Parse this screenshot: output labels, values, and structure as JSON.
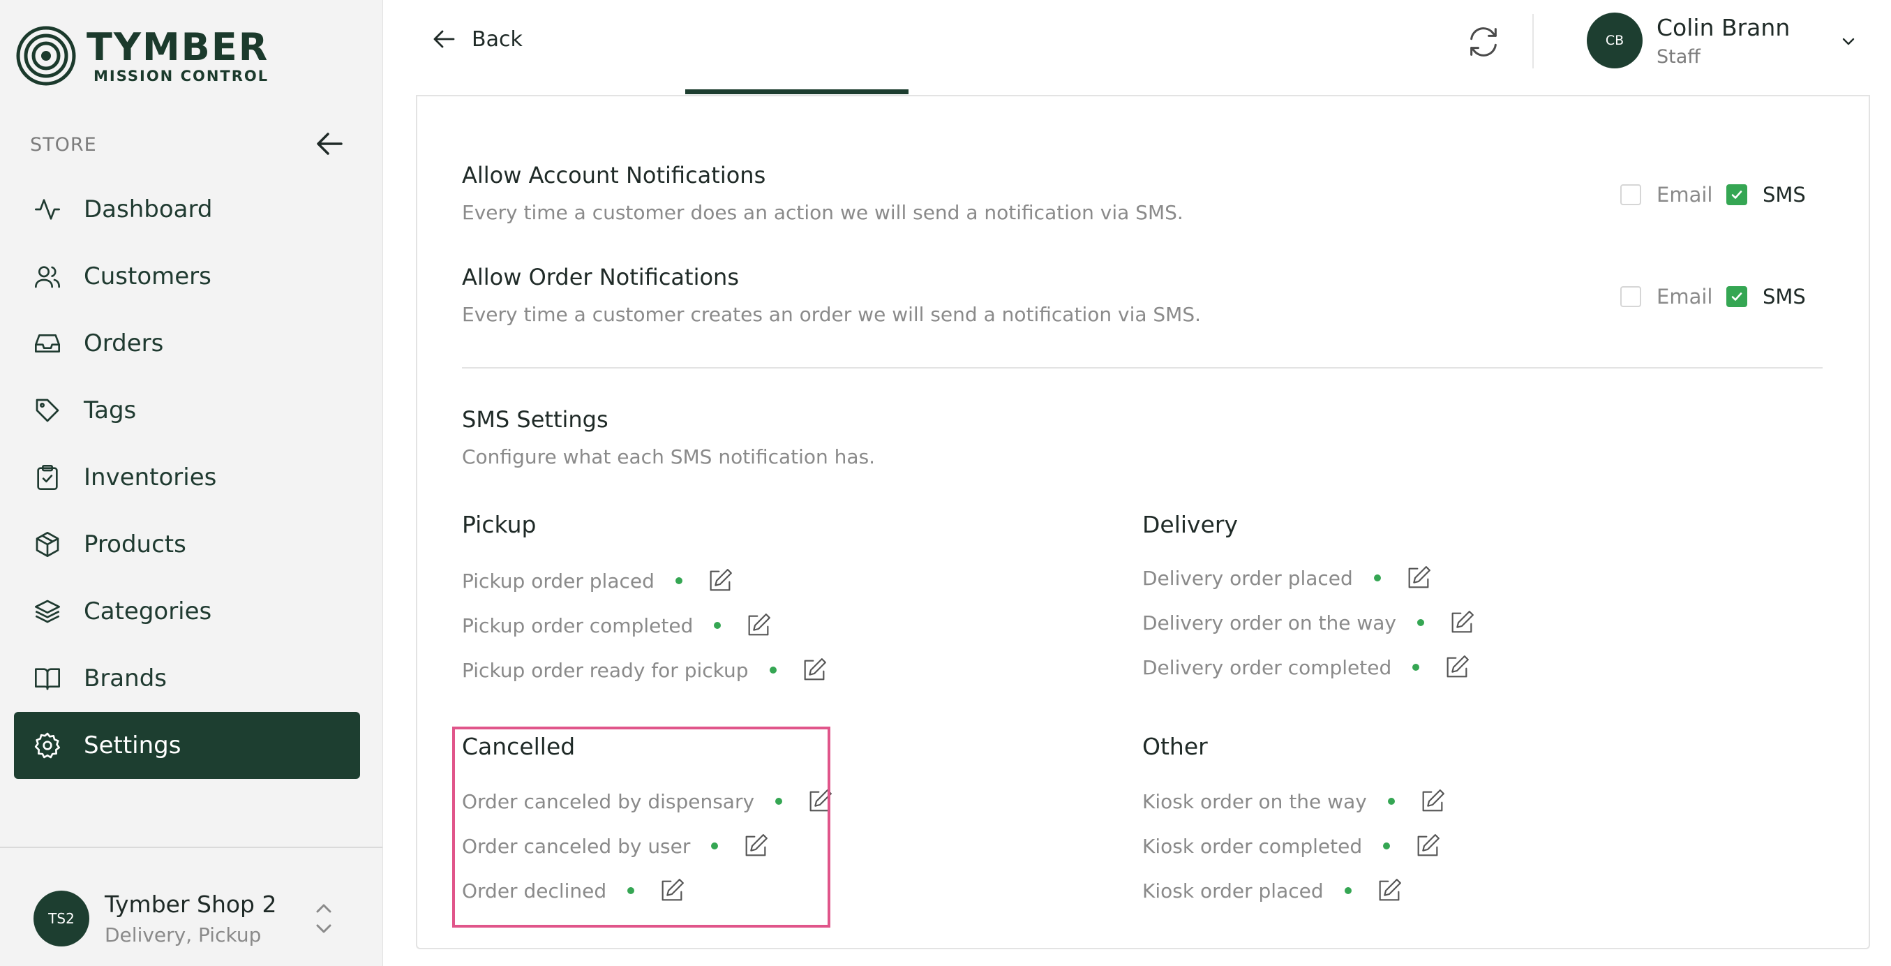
{
  "brand": {
    "title": "TYMBER",
    "subtitle": "MISSION CONTROL"
  },
  "sidebar": {
    "section_label": "STORE",
    "items": [
      {
        "label": "Dashboard",
        "icon": "activity-icon"
      },
      {
        "label": "Customers",
        "icon": "users-icon"
      },
      {
        "label": "Orders",
        "icon": "inbox-icon"
      },
      {
        "label": "Tags",
        "icon": "tag-icon"
      },
      {
        "label": "Inventories",
        "icon": "clipboard-check-icon"
      },
      {
        "label": "Products",
        "icon": "box-icon"
      },
      {
        "label": "Categories",
        "icon": "layers-icon"
      },
      {
        "label": "Brands",
        "icon": "book-icon"
      },
      {
        "label": "Settings",
        "icon": "gear-icon",
        "active": true
      }
    ],
    "shop": {
      "initials": "TS2",
      "name": "Tymber Shop 2",
      "modes": "Delivery, Pickup"
    }
  },
  "header": {
    "back_label": "Back",
    "user": {
      "initials": "CB",
      "name": "Colin Brann",
      "role": "Staff"
    }
  },
  "notifications": [
    {
      "title": "Allow Account Notifications",
      "description": "Every time a customer does an action we will send a notification via SMS.",
      "email_label": "Email",
      "email_checked": false,
      "sms_label": "SMS",
      "sms_checked": true
    },
    {
      "title": "Allow Order Notifications",
      "description": "Every time a customer creates an order we will send a notification via SMS.",
      "email_label": "Email",
      "email_checked": false,
      "sms_label": "SMS",
      "sms_checked": true
    }
  ],
  "sms_settings": {
    "title": "SMS Settings",
    "description": "Configure what each SMS notification has.",
    "groups": [
      {
        "title": "Pickup",
        "items": [
          "Pickup order placed",
          "Pickup order completed",
          "Pickup order ready for pickup"
        ]
      },
      {
        "title": "Delivery",
        "items": [
          "Delivery order placed",
          "Delivery order on the way",
          "Delivery order completed"
        ]
      },
      {
        "title": "Cancelled",
        "items": [
          "Order canceled by dispensary",
          "Order canceled by user",
          "Order declined"
        ]
      },
      {
        "title": "Other",
        "items": [
          "Kiosk order on the way",
          "Kiosk order completed",
          "Kiosk order placed"
        ]
      }
    ]
  },
  "colors": {
    "brand_green": "#1d3e30",
    "status_green": "#35a653",
    "highlight": "#e0558a"
  }
}
